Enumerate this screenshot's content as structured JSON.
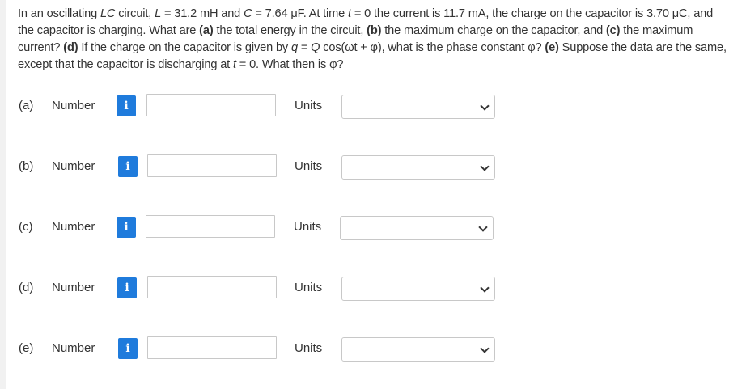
{
  "question": {
    "s1": "In an oscillating ",
    "s2_italic": "LC",
    "s3": " circuit, ",
    "s4_italic": "L",
    "s5": " = 31.2 mH and ",
    "s6_italic": "C",
    "s7": " = 7.64 μF. At time ",
    "s8_italic": "t",
    "s9": " = 0 the current is 11.7 mA, the charge on the capacitor is 3.70 μC, and the capacitor is charging. What are ",
    "a_bold": "(a)",
    "s10": " the total energy in the circuit, ",
    "b_bold": "(b)",
    "s11": " the maximum charge on the capacitor, and ",
    "c_bold": "(c)",
    "s12": " the maximum current? ",
    "d_bold": "(d)",
    "s13": " If the charge on the capacitor is given by ",
    "s14_italic": "q",
    "s15": " = ",
    "s16_italic": "Q",
    "s17": " cos(ωt + φ), what is the phase constant φ? ",
    "e_bold": "(e)",
    "s18": " Suppose the data are the same, except that the capacitor is discharging at ",
    "s19_italic": "t",
    "s20": " = 0. What then is φ?"
  },
  "parts": [
    {
      "label": "(a)",
      "number_label": "Number",
      "info_label": "i",
      "value": "",
      "units_label": "Units",
      "units_value": ""
    },
    {
      "label": "(b)",
      "number_label": "Number",
      "info_label": "i",
      "value": "",
      "units_label": "Units",
      "units_value": ""
    },
    {
      "label": "(c)",
      "number_label": "Number",
      "info_label": "i",
      "value": "",
      "units_label": "Units",
      "units_value": ""
    },
    {
      "label": "(d)",
      "number_label": "Number",
      "info_label": "i",
      "value": "",
      "units_label": "Units",
      "units_value": ""
    },
    {
      "label": "(e)",
      "number_label": "Number",
      "info_label": "i",
      "value": "",
      "units_label": "Units",
      "units_value": ""
    }
  ],
  "colors": {
    "info_button": "#1f7bdc",
    "border": "#c8c8c8",
    "text": "#333333",
    "background": "#f1f1f1"
  }
}
